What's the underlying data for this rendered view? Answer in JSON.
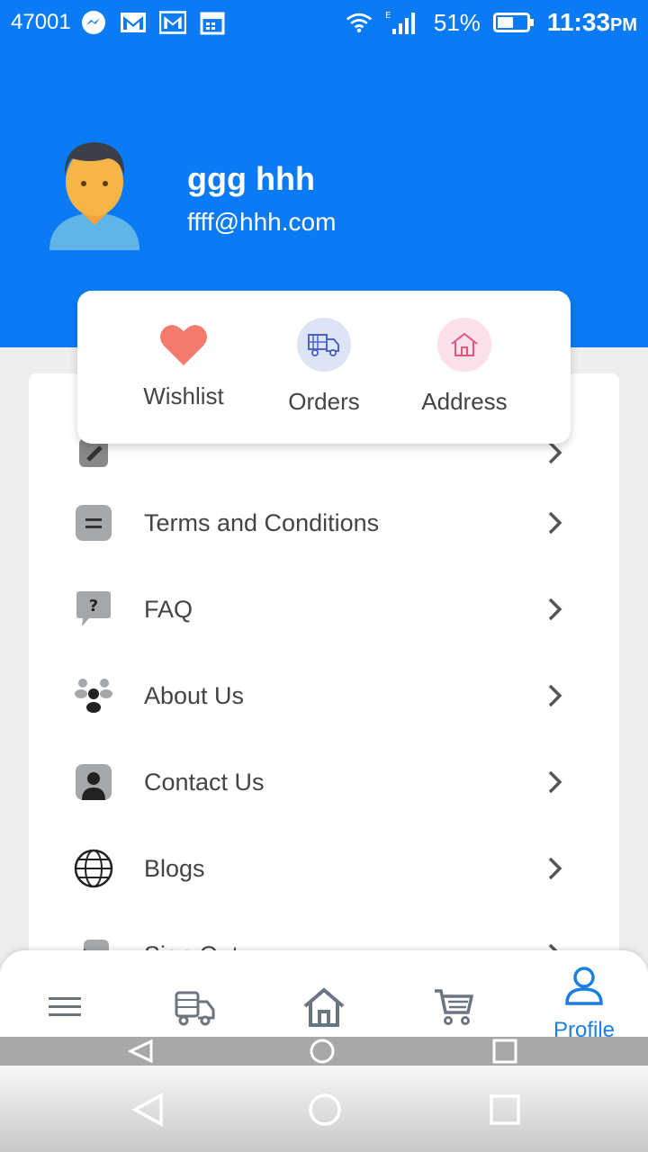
{
  "status_bar": {
    "carrier": "47001",
    "battery": "51%",
    "time": "11:33",
    "time_suffix": "PM",
    "network": "E"
  },
  "profile": {
    "name": "ggg hhh",
    "email": "ffff@hhh.com"
  },
  "quick_actions": [
    {
      "label": "Wishlist",
      "icon": "heart-icon"
    },
    {
      "label": "Orders",
      "icon": "delivery-truck-icon"
    },
    {
      "label": "Address",
      "icon": "home-icon"
    }
  ],
  "menu": {
    "items": [
      {
        "label": "Terms and Conditions",
        "icon": "document-icon"
      },
      {
        "label": "FAQ",
        "icon": "question-bubble-icon"
      },
      {
        "label": "About Us",
        "icon": "group-icon"
      },
      {
        "label": "Contact Us",
        "icon": "contact-card-icon"
      },
      {
        "label": "Blogs",
        "icon": "globe-icon"
      },
      {
        "label": "Sign Out",
        "icon": "sign-out-icon"
      }
    ]
  },
  "bottom_nav": {
    "items": [
      {
        "name": "menu",
        "icon": "hamburger-icon"
      },
      {
        "name": "orders",
        "icon": "delivery-truck-icon"
      },
      {
        "name": "home",
        "icon": "home-icon"
      },
      {
        "name": "cart",
        "icon": "cart-icon"
      }
    ],
    "profile_label": "Profile"
  },
  "colors": {
    "primary": "#0a7bf5",
    "active_tab": "#1a7fe0",
    "heart": "#f47b6b"
  }
}
